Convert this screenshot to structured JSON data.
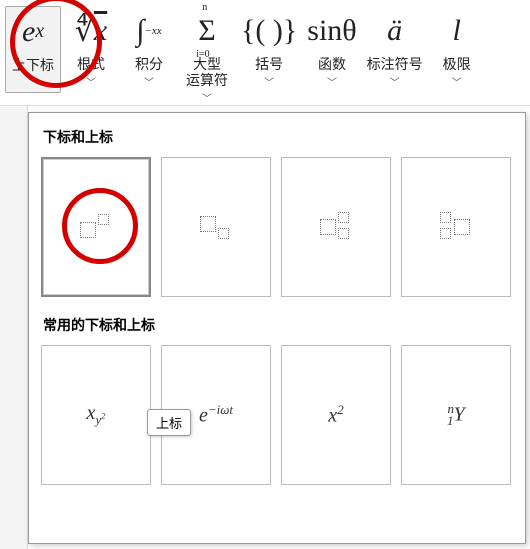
{
  "ribbon": {
    "items": [
      {
        "label": "上下标",
        "icon_html": "e<sup>x</sup>",
        "selected": true
      },
      {
        "label": "根式",
        "icon_html": "<span style='font-style:normal'>∜</span><span style='text-decoration:overline'>x</span>"
      },
      {
        "label": "积分",
        "icon_html": "∫<span style='font-size:11px;vertical-align:sub'>−x</span><span style='font-size:11px;vertical-align:super'>x</span>"
      },
      {
        "label": "大型\n运算符",
        "icon_html": "<span style='font-style:normal;position:relative;display:inline-block'><span style='position:absolute;top:-12px;left:4px;font-size:10px'>n</span>Σ<span style='position:absolute;bottom:-12px;left:-2px;font-size:10px'>i=0</span></span>"
      },
      {
        "label": "括号",
        "icon_html": "<span style='font-style:normal'>{( )}</span>"
      },
      {
        "label": "函数",
        "icon_html": "<span style='font-style:normal'>sinθ</span>"
      },
      {
        "label": "标注符号",
        "icon_html": "ä"
      },
      {
        "label": "极限",
        "icon_html": "l"
      }
    ]
  },
  "panel": {
    "section1_title": "下标和上标",
    "section2_title": "常用的下标和上标",
    "tooltip": "上标",
    "templates": [
      {
        "type": "superscript",
        "selected": true
      },
      {
        "type": "subscript"
      },
      {
        "type": "sub-superscript-right"
      },
      {
        "type": "sub-superscript-left"
      }
    ],
    "common": [
      {
        "html": "x<sub>y<sup>2</sup></sub>"
      },
      {
        "html": "e<sup>−iωt</sup>"
      },
      {
        "html": "x<sup>2</sup>"
      },
      {
        "html": "<sup>n</sup><sub style='margin-left:-7px'>1</sub>Y"
      }
    ]
  }
}
